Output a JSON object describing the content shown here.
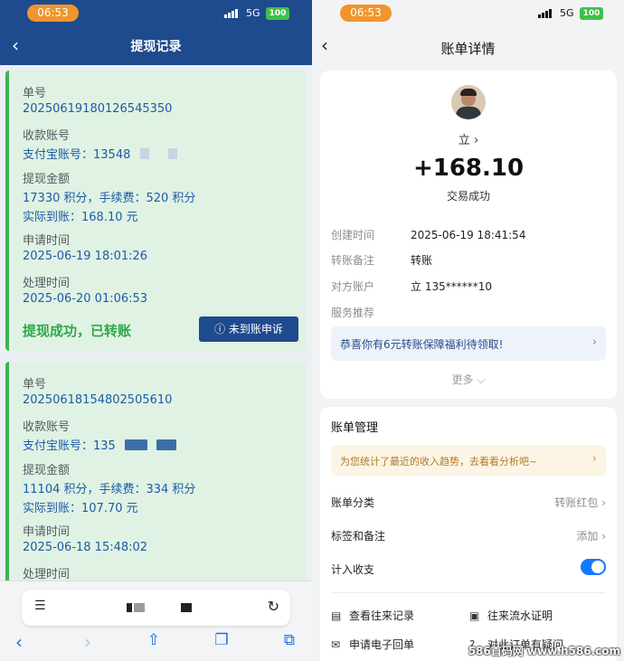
{
  "left": {
    "status": {
      "time": "06:53",
      "network": "5G",
      "battery": "100"
    },
    "nav": {
      "title": "提现记录"
    },
    "records": [
      {
        "order_label": "单号",
        "order_no": "20250619180126545350",
        "account_label": "收款账号",
        "account": "支付宝账号：13548",
        "amount_label": "提现金额",
        "amount": "17330 积分，手续费：520 积分",
        "received": "实际到账：168.10 元",
        "apply_label": "申请时间",
        "apply_time": "2025-06-19 18:01:26",
        "process_label": "处理时间",
        "process_time": "2025-06-20 01:06:53",
        "status": "提现成功，已转账",
        "appeal_button": "ⓘ 未到账申诉"
      },
      {
        "order_label": "单号",
        "order_no": "20250618154802505610",
        "account_label": "收款账号",
        "account": "支付宝账号：135",
        "amount_label": "提现金额",
        "amount": "11104 积分，手续费：334 积分",
        "received": "实际到账：107.70 元",
        "apply_label": "申请时间",
        "apply_time": "2025-06-18 15:48:02",
        "process_label": "处理时间"
      }
    ]
  },
  "right": {
    "status": {
      "time": "06:53",
      "network": "5G",
      "battery": "100"
    },
    "nav": {
      "title": "账单详情"
    },
    "bill": {
      "payee": "立 ›",
      "amount": "+168.10",
      "result": "交易成功",
      "fields": [
        {
          "key": "创建时间",
          "value": "2025-06-19 18:41:54"
        },
        {
          "key": "转账备注",
          "value": "转账"
        },
        {
          "key": "对方账户",
          "value": "立 135******10"
        },
        {
          "key": "服务推荐",
          "value": ""
        }
      ],
      "promo": "恭喜你有6元转账保障福利待领取!",
      "more": "更多 ⌵"
    },
    "mgmt": {
      "title": "账单管理",
      "tip": "为您统计了最近的收入趋势，去看看分析吧~",
      "category_label": "账单分类",
      "category_value": "转账红包 ›",
      "tags_label": "标签和备注",
      "tags_value": "添加 ›",
      "count_label": "计入收支",
      "links": [
        "查看往来记录",
        "往来流水证明",
        "申请电子回单",
        "对此订单有疑问"
      ]
    }
  },
  "watermark": "586首码网 www.h586.com",
  "colors": {
    "nav_blue": "#1e4a8e",
    "success_green": "#2fa84a",
    "link_blue": "#1e5aa8",
    "toggle_blue": "#1677ff"
  }
}
